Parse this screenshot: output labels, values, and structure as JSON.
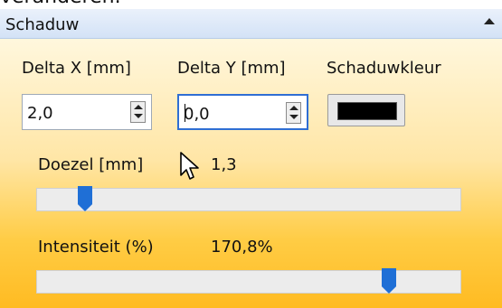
{
  "top_partial_text": "veranderen.",
  "section": {
    "title": "Schaduw"
  },
  "delta_x": {
    "label": "Delta X [mm]",
    "value": "2,0"
  },
  "delta_y": {
    "label": "Delta Y [mm]",
    "value": "0,0"
  },
  "shadow_color": {
    "label": "Schaduwkleur",
    "color": "#000000"
  },
  "blur": {
    "label": "Doezel [mm]",
    "value_text": "1,3",
    "slider_fraction": 0.1
  },
  "intensity": {
    "label": "Intensiteit (%)",
    "value_text": "170,8%",
    "slider_fraction": 0.84
  },
  "colors": {
    "header_accent": "#6f96d2",
    "active_border": "#2f6ed3",
    "thumb": "#1f6fd6"
  }
}
